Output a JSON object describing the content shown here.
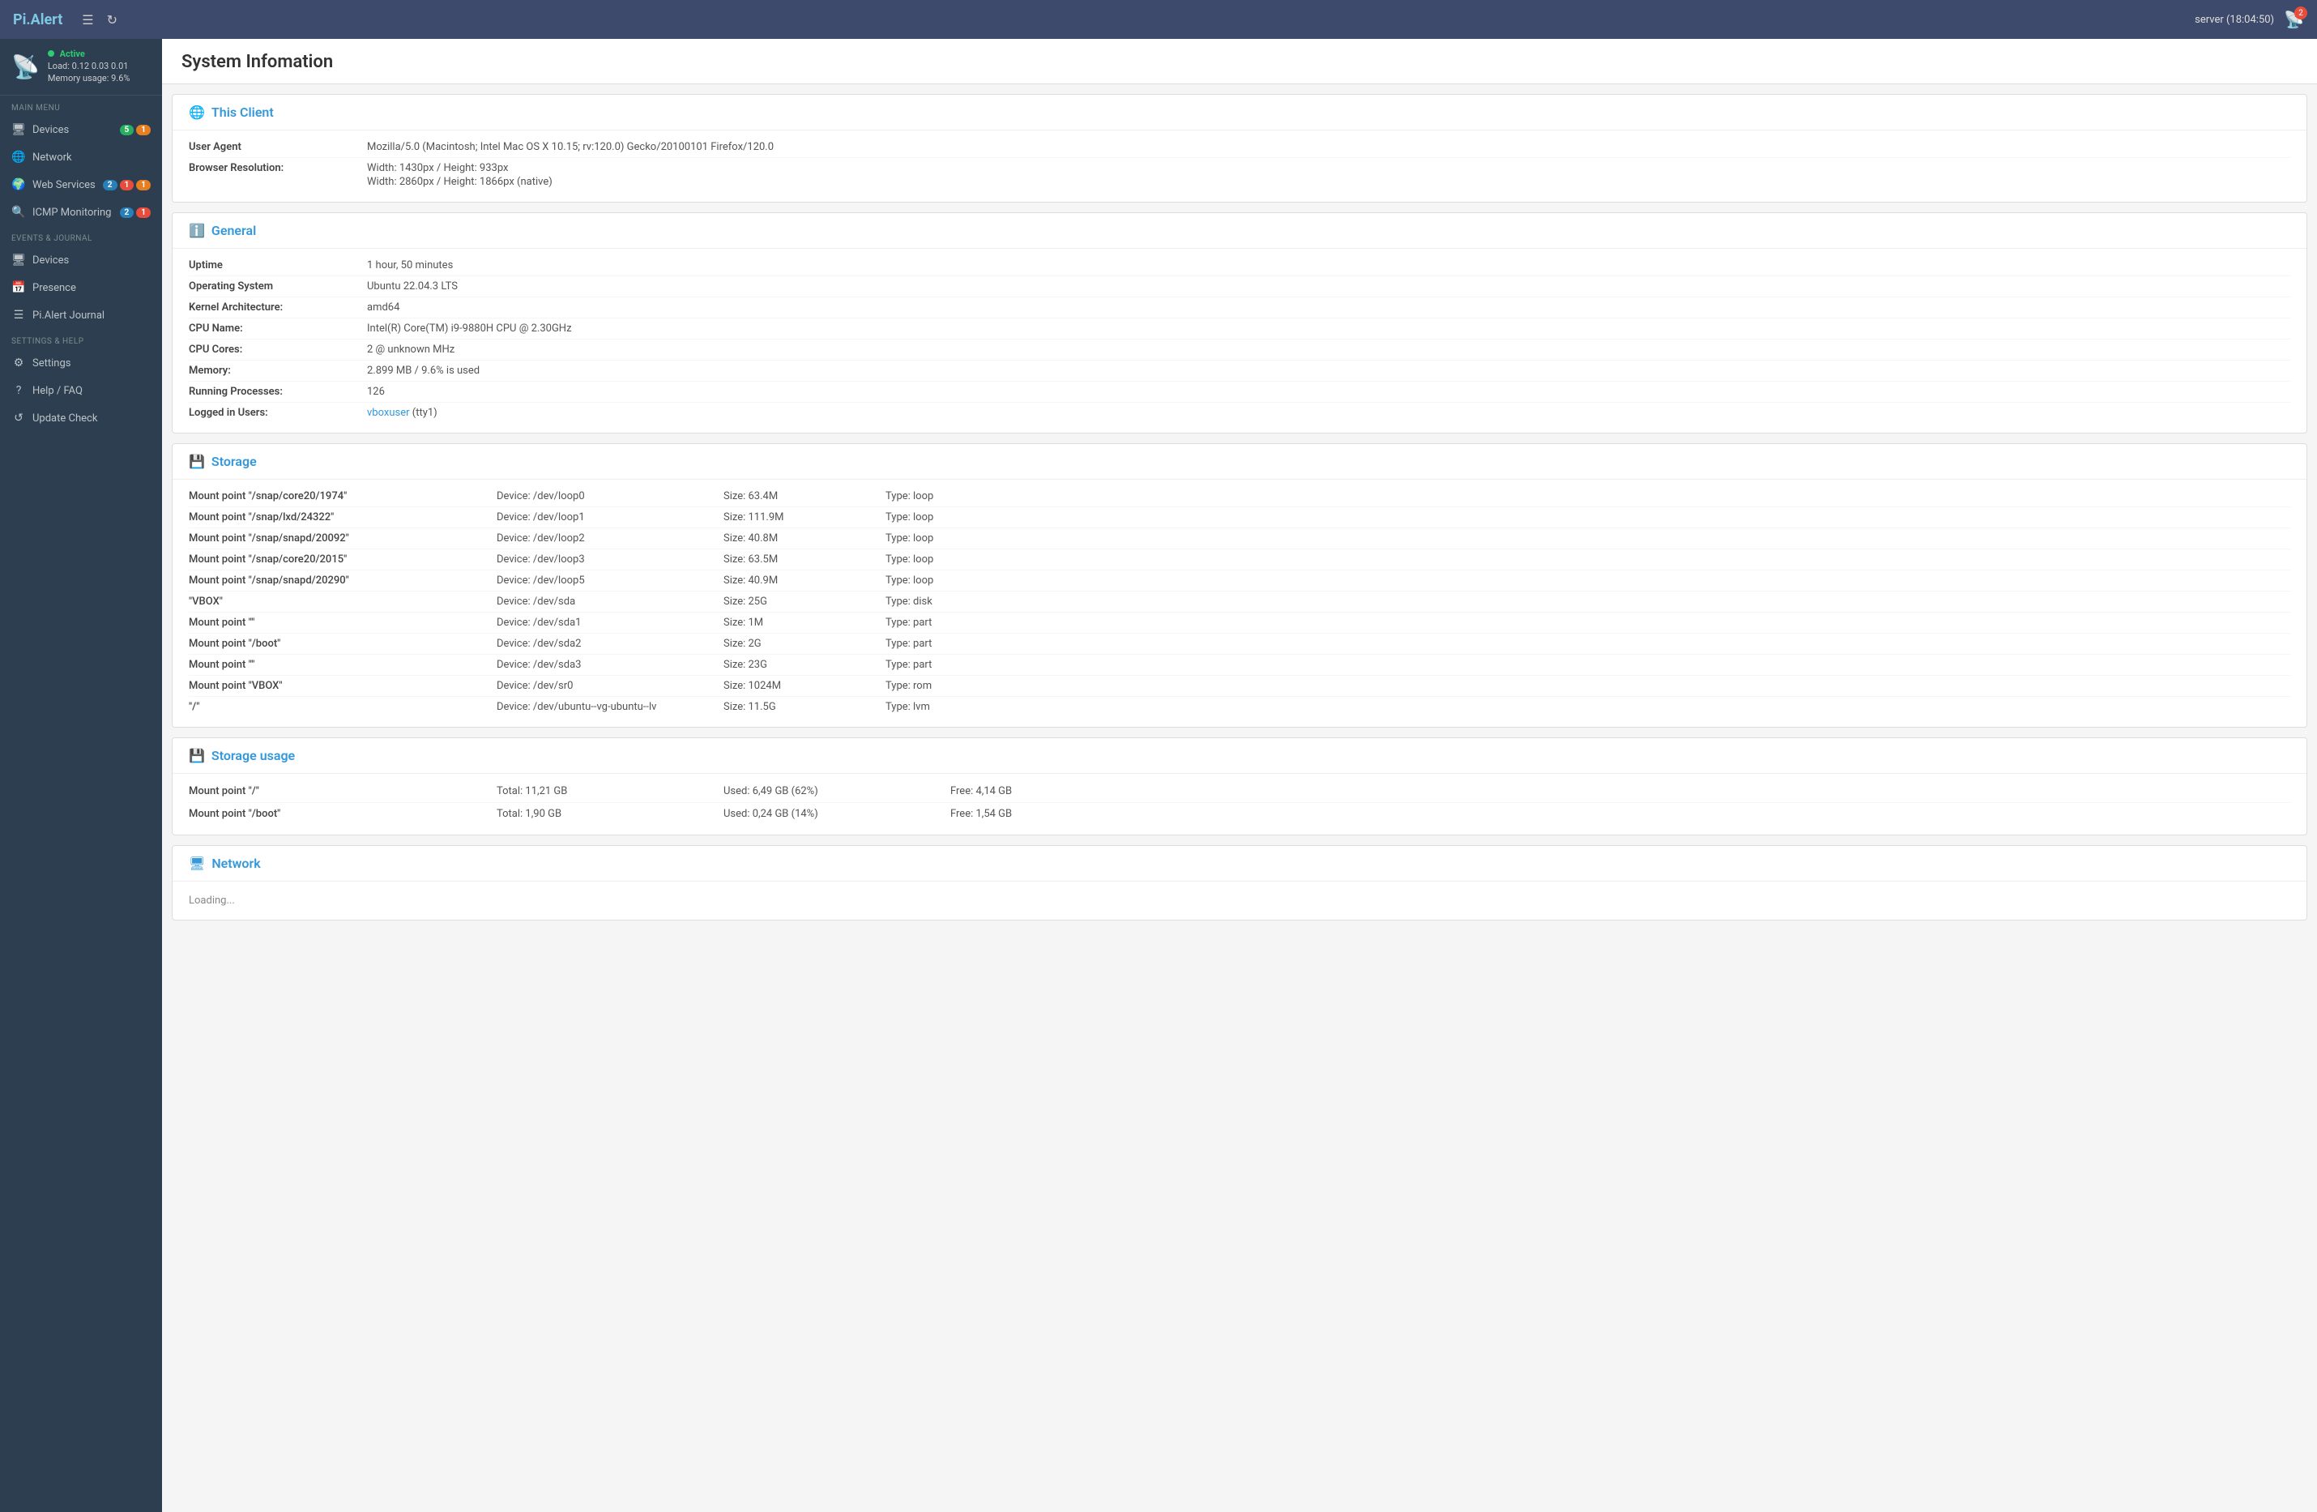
{
  "navbar": {
    "brand": "Pi.Alert",
    "brand_prefix": "Pi",
    "brand_suffix": ".Alert",
    "server_info": "server (18:04:50)",
    "refresh_icon": "↻",
    "menu_icon": "☰"
  },
  "sidebar": {
    "status": {
      "active_label": "Active",
      "load_label": "Load: 0.12  0.03  0.01",
      "memory_label": "Memory usage: 9.6%"
    },
    "main_menu_label": "MAIN MENU",
    "main_items": [
      {
        "id": "devices",
        "label": "Devices",
        "icon": "💻",
        "badges": [
          {
            "text": "5",
            "color": "green"
          },
          {
            "text": "1",
            "color": "orange"
          }
        ]
      },
      {
        "id": "network",
        "label": "Network",
        "icon": "🌐",
        "badges": []
      },
      {
        "id": "web-services",
        "label": "Web Services",
        "icon": "🌍",
        "badges": [
          {
            "text": "2",
            "color": "blue"
          },
          {
            "text": "1",
            "color": "red"
          },
          {
            "text": "1",
            "color": "orange"
          }
        ]
      },
      {
        "id": "icmp-monitoring",
        "label": "ICMP Monitoring",
        "icon": "🔍",
        "badges": [
          {
            "text": "2",
            "color": "blue"
          },
          {
            "text": "1",
            "color": "red"
          }
        ]
      }
    ],
    "events_label": "EVENTS & JOURNAL",
    "events_items": [
      {
        "id": "ev-devices",
        "label": "Devices",
        "icon": "💻",
        "badges": []
      },
      {
        "id": "presence",
        "label": "Presence",
        "icon": "📅",
        "badges": []
      },
      {
        "id": "pialert-journal",
        "label": "Pi.Alert Journal",
        "icon": "📋",
        "badges": []
      }
    ],
    "settings_label": "SETTINGS & HELP",
    "settings_items": [
      {
        "id": "settings",
        "label": "Settings",
        "icon": "⚙",
        "badges": []
      },
      {
        "id": "help-faq",
        "label": "Help / FAQ",
        "icon": "?",
        "badges": []
      },
      {
        "id": "update-check",
        "label": "Update Check",
        "icon": "↺",
        "badges": []
      }
    ]
  },
  "page": {
    "title": "System Infomation",
    "sections": {
      "this_client": {
        "title": "This Client",
        "icon": "🌐",
        "fields": [
          {
            "label": "User Agent",
            "value": "Mozilla/5.0 (Macintosh; Intel Mac OS X 10.15; rv:120.0) Gecko/20100101 Firefox/120.0",
            "multiline": false
          },
          {
            "label": "Browser Resolution:",
            "value1": "Width: 1430px / Height: 933px",
            "value2": "Width: 2860px / Height: 1866px (native)",
            "multiline": true
          }
        ]
      },
      "general": {
        "title": "General",
        "icon": "ℹ",
        "fields": [
          {
            "label": "Uptime",
            "value": "1 hour, 50 minutes"
          },
          {
            "label": "Operating System",
            "value": "Ubuntu 22.04.3 LTS"
          },
          {
            "label": "Kernel Architecture:",
            "value": "amd64"
          },
          {
            "label": "CPU Name:",
            "value": "Intel(R) Core(TM) i9-9880H CPU @ 2.30GHz"
          },
          {
            "label": "CPU Cores:",
            "value": "2 @ unknown MHz"
          },
          {
            "label": "Memory:",
            "value": "2.899 MB / 9.6% is used"
          },
          {
            "label": "Running Processes:",
            "value": "126"
          },
          {
            "label": "Logged in Users:",
            "value": "vboxuser",
            "value_suffix": " (tty1)",
            "is_link": true
          }
        ]
      },
      "storage": {
        "title": "Storage",
        "icon": "🖴",
        "rows": [
          {
            "mount": "Mount point \"/snap/core20/1974\"",
            "device": "Device: /dev/loop0",
            "size": "Size: 63.4M",
            "type": "Type: loop"
          },
          {
            "mount": "Mount point \"/snap/lxd/24322\"",
            "device": "Device: /dev/loop1",
            "size": "Size: 111.9M",
            "type": "Type: loop"
          },
          {
            "mount": "Mount point \"/snap/snapd/20092\"",
            "device": "Device: /dev/loop2",
            "size": "Size: 40.8M",
            "type": "Type: loop"
          },
          {
            "mount": "Mount point \"/snap/core20/2015\"",
            "device": "Device: /dev/loop3",
            "size": "Size: 63.5M",
            "type": "Type: loop"
          },
          {
            "mount": "Mount point \"/snap/snapd/20290\"",
            "device": "Device: /dev/loop5",
            "size": "Size: 40.9M",
            "type": "Type: loop"
          },
          {
            "mount": "\"VBOX\"",
            "device": "Device: /dev/sda",
            "size": "Size: 25G",
            "type": "Type: disk"
          },
          {
            "mount": "Mount point \"\"",
            "device": "Device: /dev/sda1",
            "size": "Size: 1M",
            "type": "Type: part"
          },
          {
            "mount": "Mount point \"/boot\"",
            "device": "Device: /dev/sda2",
            "size": "Size: 2G",
            "type": "Type: part"
          },
          {
            "mount": "Mount point \"\"",
            "device": "Device: /dev/sda3",
            "size": "Size: 23G",
            "type": "Type: part"
          },
          {
            "mount": "Mount point \"VBOX\"",
            "device": "Device: /dev/sr0",
            "size": "Size: 1024M",
            "type": "Type: rom"
          },
          {
            "mount": "\"/\"",
            "device": "Device: /dev/ubuntu--vg-ubuntu--lv",
            "size": "Size: 11.5G",
            "type": "Type: lvm"
          }
        ]
      },
      "storage_usage": {
        "title": "Storage usage",
        "icon": "🖴",
        "rows": [
          {
            "mount": "Mount point \"/\"",
            "total": "Total: 11,21 GB",
            "used": "Used: 6,49 GB (62%)",
            "free": "Free: 4,14 GB"
          },
          {
            "mount": "Mount point \"/boot\"",
            "total": "Total: 1,90 GB",
            "used": "Used: 0,24 GB (14%)",
            "free": "Free: 1,54 GB"
          }
        ]
      },
      "network": {
        "title": "Network",
        "icon": "🌐"
      }
    }
  }
}
